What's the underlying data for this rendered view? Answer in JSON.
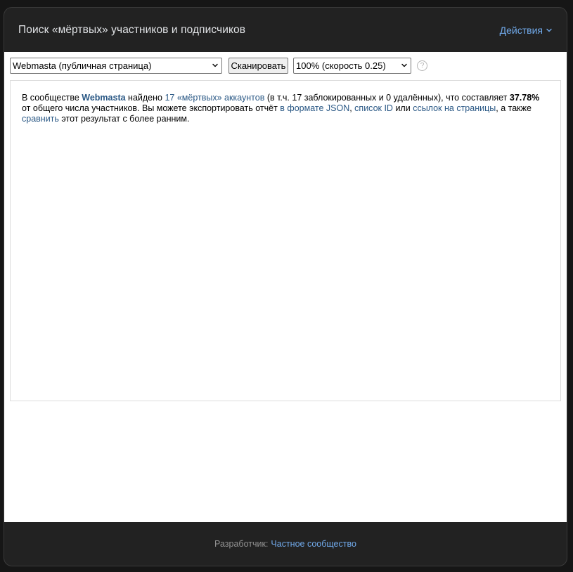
{
  "header": {
    "title": "Поиск «мёртвых» участников и подписчиков",
    "actions_label": "Действия"
  },
  "toolbar": {
    "community_select": "Webmasta (публичная страница)",
    "scan_button": "Сканировать",
    "speed_select": "100% (скорость 0.25)",
    "help": "?"
  },
  "result": {
    "t1": "В сообществе ",
    "community": "Webmasta",
    "t2": " найдено ",
    "dead_link": "17 «мёртвых» аккаунтов",
    "t3": " (в т.ч. 17 заблокированных и 0 удалённых), что составляет ",
    "percent": "37.78%",
    "t4": " от общего числа участников. Вы можете экспортировать отчёт ",
    "json_link": "в формате JSON",
    "t5": ", ",
    "id_link": "список ID",
    "t6": " или ",
    "links_link": "ссылок на страницы",
    "t7": ", а также ",
    "compare_link": "сравнить",
    "t8": " этот результат с более ранним."
  },
  "footer": {
    "label": "Разработчик:",
    "link": "Частное сообщество"
  },
  "colors": {
    "accent": "#71aaeb",
    "link": "#2a5885",
    "header_bg": "#222222"
  }
}
